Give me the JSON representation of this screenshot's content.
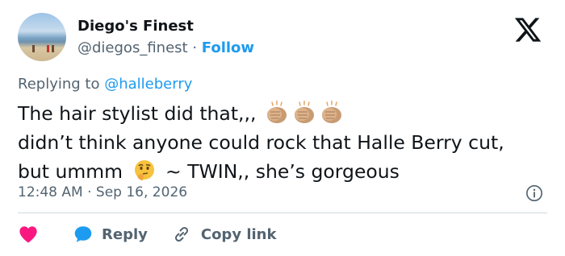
{
  "author": {
    "name": "Diego's Finest",
    "handle": "@diegos_finest",
    "separator": "·",
    "follow_label": "Follow"
  },
  "reply_to": {
    "prefix": "Replying to",
    "mention": "@halleberry"
  },
  "tweet": {
    "line1": "The hair stylist did that,,,",
    "line2": "didn’t think anyone could rock that Halle Berry cut,",
    "line3_a": "but ummm",
    "line3_b": "~ TWIN,, she’s gorgeous",
    "emoji_line1": [
      "clapping-hands",
      "clapping-hands",
      "clapping-hands"
    ],
    "emoji_line3": "thinking-face"
  },
  "meta": {
    "time": "12:48 AM",
    "separator": "·",
    "date": "Sep 16, 2026"
  },
  "actions": {
    "reply_label": "Reply",
    "copy_label": "Copy link"
  },
  "colors": {
    "link": "#1d9bf0",
    "secondary_text": "#536471",
    "heart": "#f91880",
    "divider": "#cfd9de"
  },
  "icons": [
    "x-logo-icon",
    "info-icon",
    "heart-icon",
    "reply-bubble-icon",
    "link-icon"
  ]
}
